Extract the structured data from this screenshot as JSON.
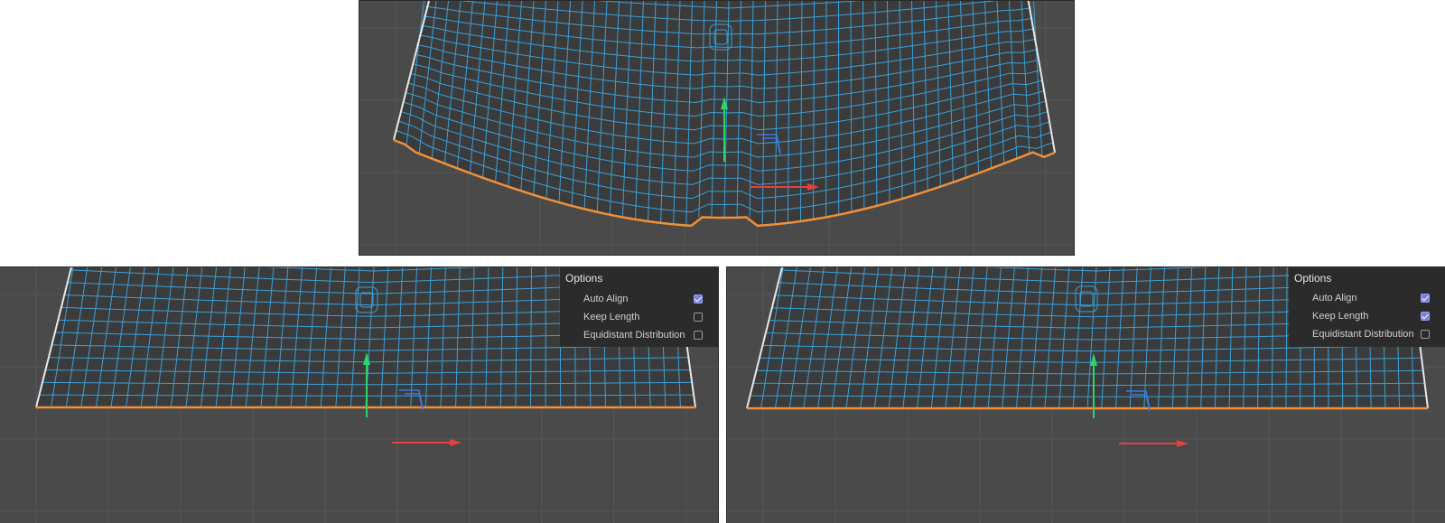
{
  "panels": [
    {
      "id": "left",
      "title": "Options",
      "options": [
        {
          "label": "Auto Align",
          "checked": true
        },
        {
          "label": "Keep Length",
          "checked": false
        },
        {
          "label": "Equidistant Distribution",
          "checked": false
        }
      ]
    },
    {
      "id": "right",
      "title": "Options",
      "options": [
        {
          "label": "Auto Align",
          "checked": true
        },
        {
          "label": "Keep Length",
          "checked": true
        },
        {
          "label": "Equidistant Distribution",
          "checked": false
        }
      ]
    }
  ],
  "colors": {
    "viewport_bg": "#4a4a4a",
    "mesh": "#3aa0d8",
    "selected_edge": "#f0903a",
    "outline": "#e8e8e8",
    "axis_y": "#2ed36a",
    "axis_x": "#e84040",
    "axis_z": "#3a78e0",
    "checkbox_on": "#7b7fe0"
  }
}
